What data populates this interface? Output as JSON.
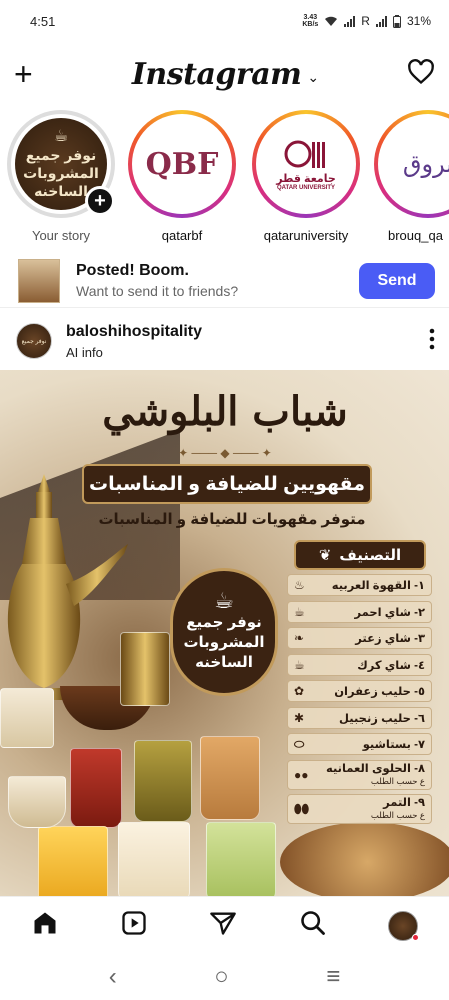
{
  "status_bar": {
    "time": "4:51",
    "net_speed_value": "3.43",
    "net_speed_unit": "KB/s",
    "roaming": "R",
    "battery": "31%"
  },
  "header": {
    "brand": "Instagram",
    "chevron": "⌄"
  },
  "stories": [
    {
      "label": "Your story",
      "avatar_text": "نوفر جميع المشروبات الساخنه"
    },
    {
      "label": "qatarbf",
      "avatar_text": "QBF"
    },
    {
      "label": "qataruniversity",
      "avatar_text": "جامعة قطر",
      "avatar_sub": "QATAR UNIVERSITY"
    },
    {
      "label": "brouq_qa",
      "avatar_text": "بروق"
    }
  ],
  "posted": {
    "title": "Posted! Boom.",
    "subtitle": "Want to send it to friends?",
    "button": "Send"
  },
  "post": {
    "username": "baloshihospitality",
    "subtitle": "AI info",
    "avatar_text": "نوفر جميع"
  },
  "poster": {
    "title": "شباب البلوشي",
    "banner": "مقهويين للضيافة و المناسبات",
    "subline": "متوفر مقهويات للضيافة و المناسبات",
    "category": "التصنيف",
    "badge_line1": "نوفر جميع",
    "badge_line2": "المشروبات",
    "badge_line3": "الساخنه",
    "menu": [
      {
        "text": "١- القهوة العربيه",
        "icon": "dallah-icon"
      },
      {
        "text": "٢- شاي احمر",
        "icon": "cup-icon"
      },
      {
        "text": "٣- شاي زعتر",
        "icon": "leaf-icon"
      },
      {
        "text": "٤- شاي كرك",
        "icon": "cup-icon"
      },
      {
        "text": "٥- حليب زعفران",
        "icon": "flower-icon"
      },
      {
        "text": "٦- حليب زنجبيل",
        "icon": "ginger-icon"
      },
      {
        "text": "٧- بستاشيو",
        "icon": "pistachio-icon"
      },
      {
        "text": "٨- الحلوى العمانيه",
        "note": "ع حسب الطلب",
        "icon": "sweets-icon"
      },
      {
        "text": "٩- التمر",
        "note": "ع حسب الطلب",
        "icon": "dates-icon"
      }
    ]
  },
  "colors": {
    "send_button": "#4a5cf5",
    "poster_dark": "#3b2312",
    "poster_gold": "#c19a5b",
    "notification_dot": "#e4263b"
  }
}
